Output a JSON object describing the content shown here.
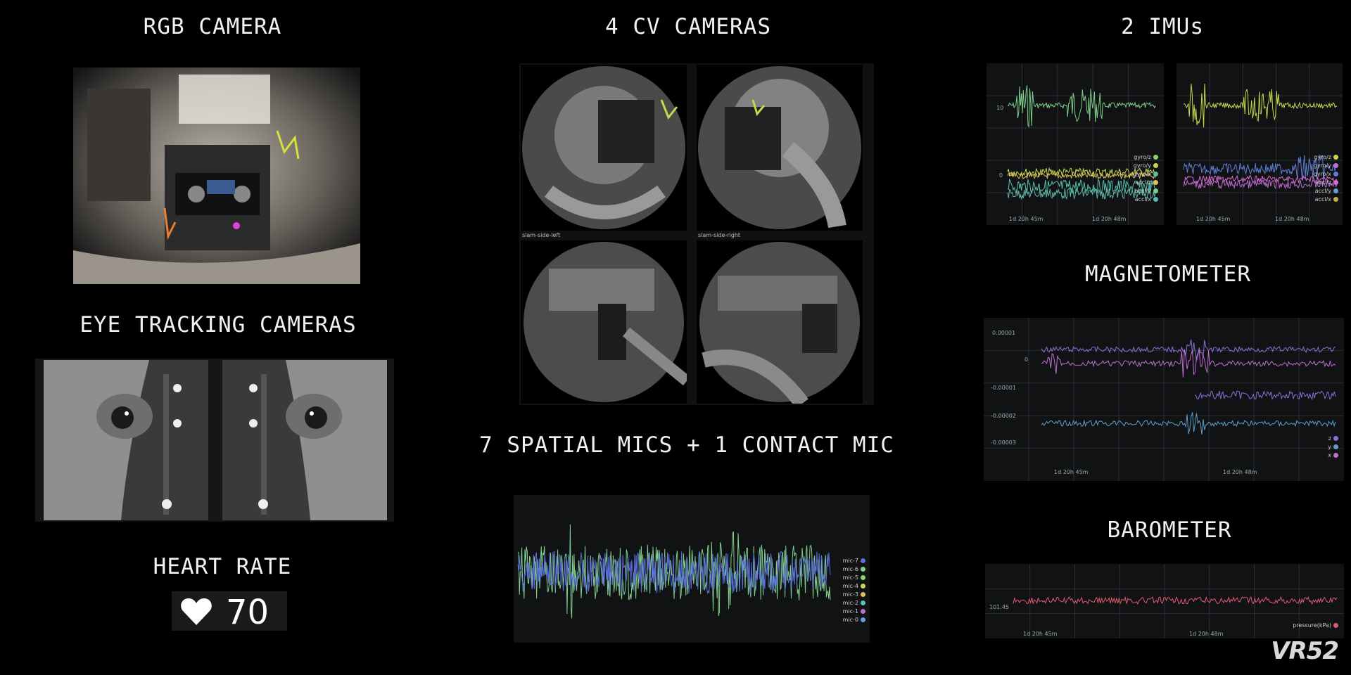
{
  "sections": {
    "rgb_camera": "RGB CAMERA",
    "cv_cameras": "4 CV CAMERAS",
    "imus": "2 IMUs",
    "eye_tracking": "EYE TRACKING CAMERAS",
    "magnetometer": "MAGNETOMETER",
    "mics": "7 SPATIAL MICS + 1 CONTACT MIC",
    "barometer": "BAROMETER",
    "heart_rate": "HEART RATE"
  },
  "heart_rate": {
    "value": "70",
    "icon": "heart-icon"
  },
  "cv_camera_labels": {
    "left": "slam-side-left",
    "right": "slam-side-right"
  },
  "imu_legend_left": [
    {
      "label": "gyro/z",
      "color": "#8bd36b"
    },
    {
      "label": "gyro/y",
      "color": "#c6d84e"
    },
    {
      "label": "gyro/x",
      "color": "#5fb7a8"
    },
    {
      "label": "accl/z",
      "color": "#e0c060"
    },
    {
      "label": "accl/y",
      "color": "#7fd08a"
    },
    {
      "label": "accl/x",
      "color": "#56c0b0"
    }
  ],
  "imu_legend_right": [
    {
      "label": "gyro/z",
      "color": "#c5d84a"
    },
    {
      "label": "gyro/y",
      "color": "#c06ed0"
    },
    {
      "label": "gyro/x",
      "color": "#5f7fd6"
    },
    {
      "label": "accl/z",
      "color": "#d86bd0"
    },
    {
      "label": "accl/y",
      "color": "#6b9bd8"
    },
    {
      "label": "accl/x",
      "color": "#c9a84a"
    }
  ],
  "imu_ticks": {
    "y_top": "10",
    "y_mid": "0",
    "t1": "1d 20h 45m",
    "t2": "1d 20h 48m"
  },
  "mag_ticks": {
    "y": [
      "0.00001",
      "0",
      "-0.00001",
      "-0.00002",
      "-0.00003"
    ],
    "t1": "1d 20h 45m",
    "t2": "1d 20h 48m"
  },
  "mag_legend": [
    {
      "label": "z",
      "color": "#8a6fd8"
    },
    {
      "label": "y",
      "color": "#5fa0c8"
    },
    {
      "label": "x",
      "color": "#c06ed0"
    }
  ],
  "mic_legend": [
    {
      "label": "mic-7",
      "color": "#5a6fd8"
    },
    {
      "label": "mic-6",
      "color": "#7fd08a"
    },
    {
      "label": "mic-5",
      "color": "#8bd36b"
    },
    {
      "label": "mic-4",
      "color": "#c6d84e"
    },
    {
      "label": "mic-3",
      "color": "#e0c060"
    },
    {
      "label": "mic-2",
      "color": "#56c0b0"
    },
    {
      "label": "mic-1",
      "color": "#c06ed0"
    },
    {
      "label": "mic-0",
      "color": "#6b9bd8"
    }
  ],
  "baro": {
    "y_tick": "101.45",
    "t1": "1d 20h 45m",
    "t2": "1d 20h 48m",
    "legend": "pressure(kPa)",
    "color": "#e05a6e"
  },
  "watermark": "VR52"
}
